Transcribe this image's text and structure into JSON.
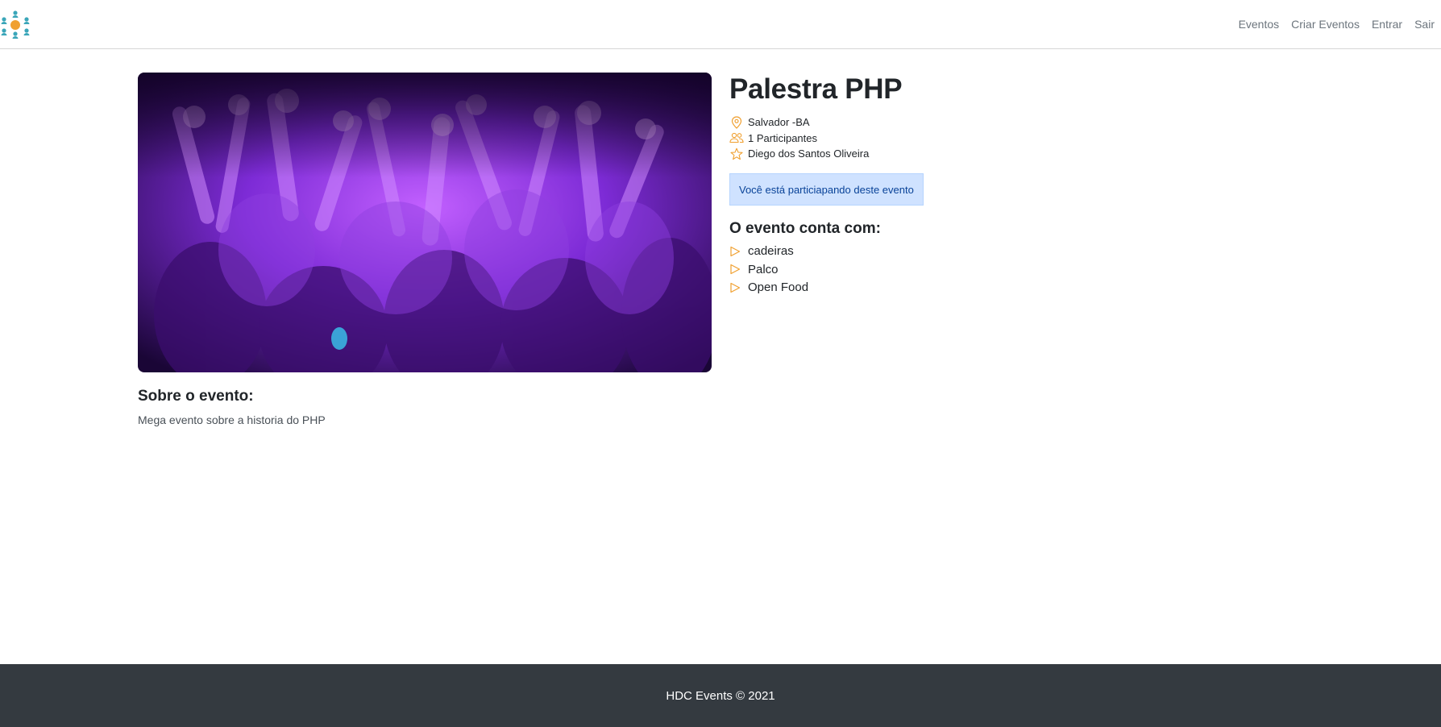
{
  "header": {
    "logo_icon": "people-network-icon",
    "nav": [
      {
        "label": "Eventos"
      },
      {
        "label": "Criar Eventos"
      },
      {
        "label": "Entrar"
      },
      {
        "label": "Sair"
      }
    ]
  },
  "event": {
    "title": "Palestra PHP",
    "city": "Salvador -BA",
    "participants": "1 Participantes",
    "owner": "Diego dos Santos Oliveira",
    "status_message": "Você está particiapando deste evento",
    "features_title": "O evento conta com:",
    "features": [
      "cadeiras",
      "Palco",
      "Open Food"
    ],
    "about_title": "Sobre o evento:",
    "description": "Mega evento sobre a historia do PHP"
  },
  "footer": {
    "text": "HDC Events © 2021"
  },
  "colors": {
    "accent": "#f0a030",
    "alert_bg": "#cfe2ff",
    "footer_bg": "#343a40"
  }
}
